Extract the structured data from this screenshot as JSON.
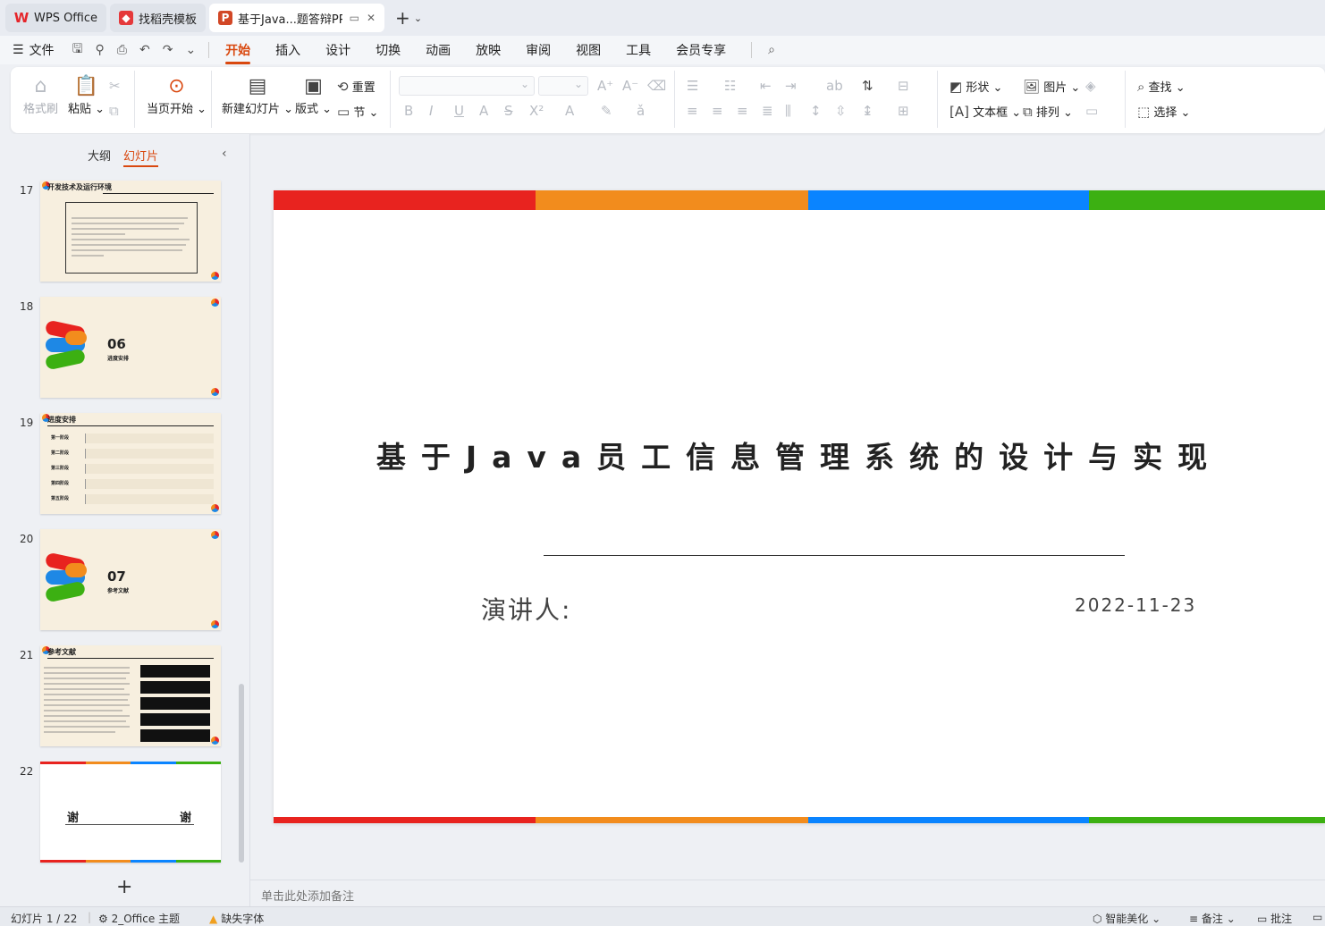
{
  "tabs": [
    {
      "label": "WPS Office",
      "icon": "wps-logo-icon"
    },
    {
      "label": "找稻壳模板",
      "icon": "daoke-logo-icon"
    },
    {
      "label": "基于Java...题答辩PPT",
      "icon": "ppt-file-icon"
    }
  ],
  "menu": {
    "file": "文件",
    "items": [
      "开始",
      "插入",
      "设计",
      "切换",
      "动画",
      "放映",
      "审阅",
      "视图",
      "工具",
      "会员专享"
    ],
    "active": "开始"
  },
  "ribbon": {
    "format_painter": "格式刷",
    "paste": "粘贴",
    "play_from_current": "当页开始",
    "new_slide": "新建幻灯片",
    "layout": "版式",
    "reset": "重置",
    "section": "节",
    "shape": "形状",
    "picture": "图片",
    "find": "查找",
    "textbox": "文本框",
    "arrange": "排列",
    "select": "选择"
  },
  "left_panel": {
    "tab_outline": "大纲",
    "tab_slides": "幻灯片",
    "slides": [
      {
        "num": "17",
        "title": "开发技术及运行环境"
      },
      {
        "num": "18",
        "section_num": "06",
        "section_title": "进度安排"
      },
      {
        "num": "19",
        "title": "进度安排",
        "rows": [
          "第一阶段",
          "第二阶段",
          "第三阶段",
          "第四阶段",
          "第五阶段"
        ]
      },
      {
        "num": "20",
        "section_num": "07",
        "section_title": "参考文献"
      },
      {
        "num": "21",
        "title": "参考文献"
      },
      {
        "num": "22",
        "left": "谢",
        "right": "谢"
      }
    ]
  },
  "slide": {
    "title": "基于Java员工信息管理系统的设计与实现",
    "speaker_label": "演讲人:",
    "date": "2022-11-23",
    "stripe_colors": [
      "#e8231f",
      "#f28c1d",
      "#0a84ff",
      "#3cb012"
    ]
  },
  "notes_placeholder": "单击此处添加备注",
  "status": {
    "slide_count": "幻灯片 1 / 22",
    "theme": "2_Office 主题",
    "missing_font": "缺失字体",
    "smart_beautify": "智能美化",
    "notes": "备注",
    "comments": "批注"
  }
}
